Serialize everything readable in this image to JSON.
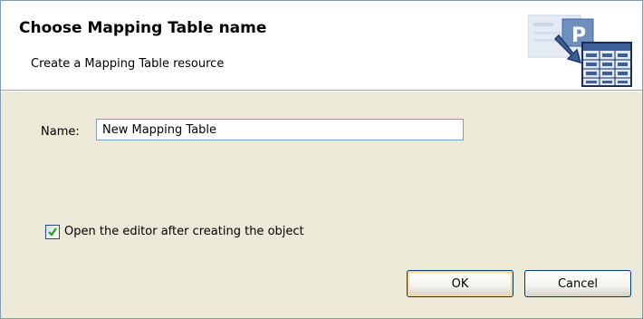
{
  "dialog": {
    "title": "Choose Mapping Table name",
    "subtitle": "Create a Mapping Table resource",
    "header_icon": "mapping-table-wizard-icon"
  },
  "form": {
    "name_label": "Name:",
    "name_value": "New Mapping Table",
    "open_editor_label": "Open the editor after creating the object",
    "open_editor_checked": true
  },
  "buttons": {
    "ok_label": "OK",
    "cancel_label": "Cancel"
  },
  "colors": {
    "dialog_background": "#ece9d8",
    "header_background": "#ffffff",
    "input_border": "#7f9db9",
    "checkmark": "#21a121",
    "button_border": "#003c74"
  }
}
